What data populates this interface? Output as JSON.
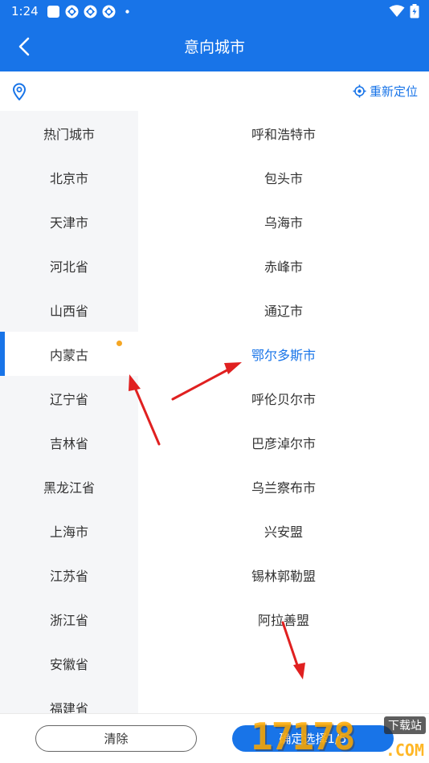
{
  "status": {
    "time": "1:24",
    "icons": [
      "app-square-icon",
      "app-diamond-icon",
      "app-diamond-icon",
      "app-diamond-icon",
      "more-dot-icon"
    ],
    "right_icons": [
      "wifi-icon",
      "battery-icon"
    ]
  },
  "header": {
    "title": "意向城市",
    "back_icon": "chevron-left-icon",
    "color": "#1874e8"
  },
  "location": {
    "pin_icon": "location-pin-icon",
    "relocate_label": "重新定位",
    "relocate_icon": "target-icon"
  },
  "provinces": {
    "items": [
      "热门城市",
      "北京市",
      "天津市",
      "河北省",
      "山西省",
      "内蒙古",
      "辽宁省",
      "吉林省",
      "黑龙江省",
      "上海市",
      "江苏省",
      "浙江省",
      "安徽省",
      "福建省"
    ],
    "active_index": 5,
    "badge_color": "#f5a623"
  },
  "cities": {
    "items": [
      "呼和浩特市",
      "包头市",
      "乌海市",
      "赤峰市",
      "通辽市",
      "鄂尔多斯市",
      "呼伦贝尔市",
      "巴彦淖尔市",
      "乌兰察布市",
      "兴安盟",
      "锡林郭勒盟",
      "阿拉善盟"
    ],
    "selected_index": 5,
    "selected_color": "#1874e8"
  },
  "footer": {
    "clear_label": "清除",
    "confirm_label": "确定选择1/5"
  },
  "watermark": {
    "number": "17178",
    "tag": "下载站",
    "suffix": ".COM"
  },
  "annotations": {
    "arrow_color": "#e02020"
  }
}
